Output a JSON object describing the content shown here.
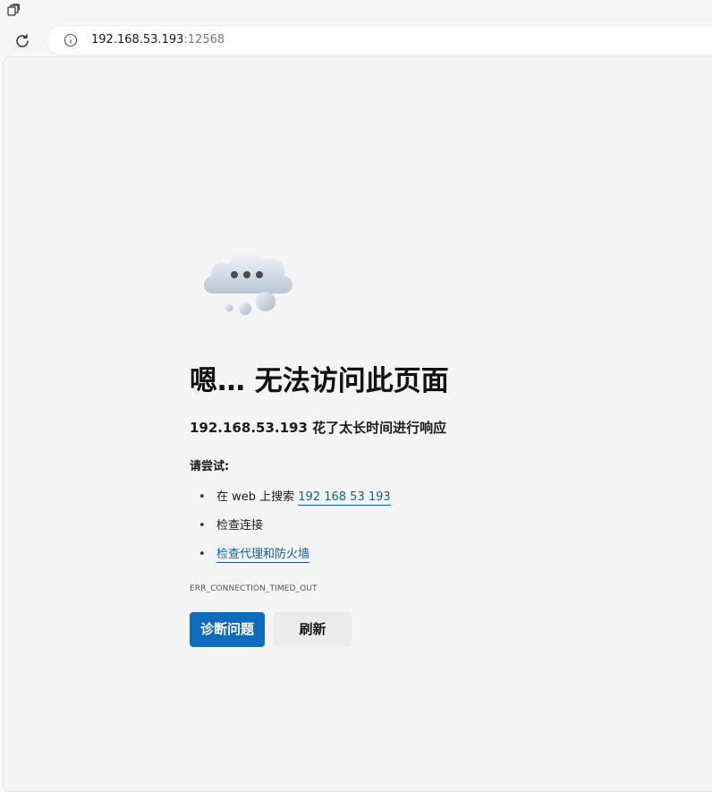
{
  "browser": {
    "app_icon": "collections-icon",
    "refresh_icon": "refresh-icon",
    "info_icon": "info-icon",
    "url_host": "192.168.53.193",
    "url_port": ":12568"
  },
  "error_page": {
    "illustration": "cloud-icon",
    "heading": "嗯… 无法访问此页面",
    "subheading": "192.168.53.193 花了太长时间进行响应",
    "try_label": "请尝试:",
    "suggestions": [
      {
        "bullet": "•",
        "prefix": "在 web 上搜索 ",
        "link": "192 168 53 193"
      },
      {
        "bullet": "•",
        "text": "检查连接"
      },
      {
        "bullet": "•",
        "link": "检查代理和防火墙"
      }
    ],
    "error_code": "ERR_CONNECTION_TIMED_OUT",
    "diagnose_button": "诊断问题",
    "refresh_button": "刷新"
  },
  "colors": {
    "accent": "#0f6cbd",
    "link": "#0f5fa8",
    "background": "#f5f5f5"
  }
}
